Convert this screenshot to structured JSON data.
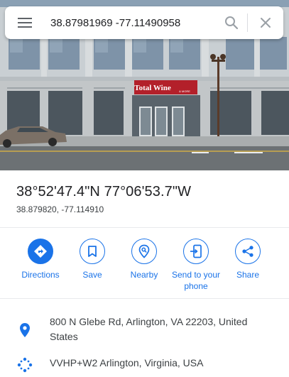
{
  "search": {
    "value": "38.87981969 -77.11490958",
    "menu_icon": "hamburger-menu-icon",
    "search_icon": "magnifier-icon",
    "close_icon": "close-x-icon"
  },
  "photo": {
    "storefront_sign": "Total Wine",
    "storefront_sign_sub": "& MORE"
  },
  "place": {
    "title": "38°52'47.4\"N 77°06'53.7\"W",
    "subtitle": "38.879820, -77.114910"
  },
  "actions": [
    {
      "label": "Directions",
      "icon": "directions-arrow-icon"
    },
    {
      "label": "Save",
      "icon": "bookmark-icon"
    },
    {
      "label": "Nearby",
      "icon": "nearby-pin-icon"
    },
    {
      "label": "Send to your phone",
      "icon": "send-to-phone-icon"
    },
    {
      "label": "Share",
      "icon": "share-icon"
    }
  ],
  "details": {
    "address": "800 N Glebe Rd, Arlington, VA 22203, United States",
    "plus_code": "VVHP+W2 Arlington, Virginia, USA"
  },
  "colors": {
    "accent": "#1a73e8",
    "text_primary": "#202124",
    "text_secondary": "#3c4043",
    "divider": "#e8eaed",
    "sign_red": "#b3202a"
  }
}
